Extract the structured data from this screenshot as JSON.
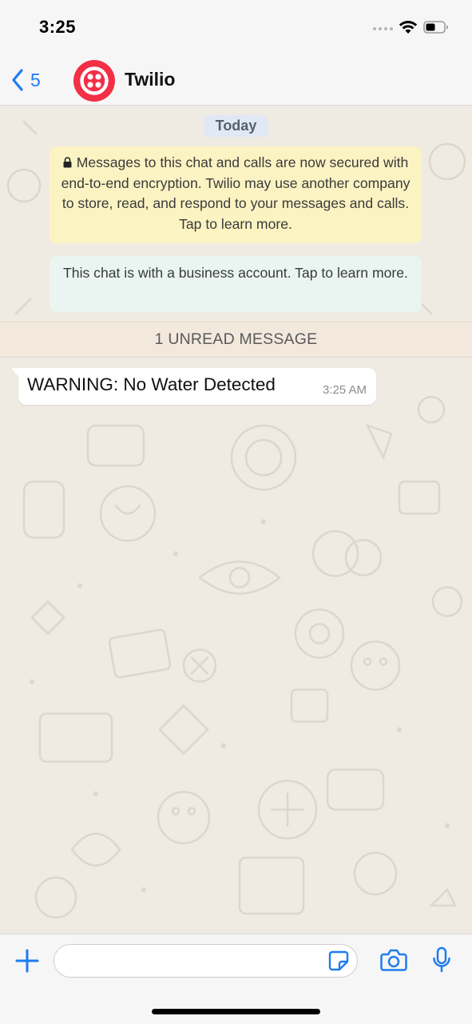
{
  "status_bar": {
    "time": "3:25"
  },
  "header": {
    "back_count": "5",
    "contact_name": "Twilio",
    "brand_color": "#f22f46",
    "accent_color": "#1f7cf0"
  },
  "chat": {
    "date_label": "Today",
    "encryption_notice": "Messages to this chat and calls are now secured with end-to-end encryption. Twilio may use another company to store, read, and respond to your messages and calls. Tap to learn more.",
    "business_notice": "This chat is with a business account. Tap to learn more.",
    "unread_label": "1 UNREAD MESSAGE",
    "messages": [
      {
        "text": "WARNING: No Water Detected",
        "time": "3:25 AM",
        "direction": "incoming"
      }
    ]
  },
  "input_bar": {
    "placeholder": "",
    "icons": [
      "plus-icon",
      "sticker-icon",
      "camera-icon",
      "microphone-icon"
    ]
  }
}
